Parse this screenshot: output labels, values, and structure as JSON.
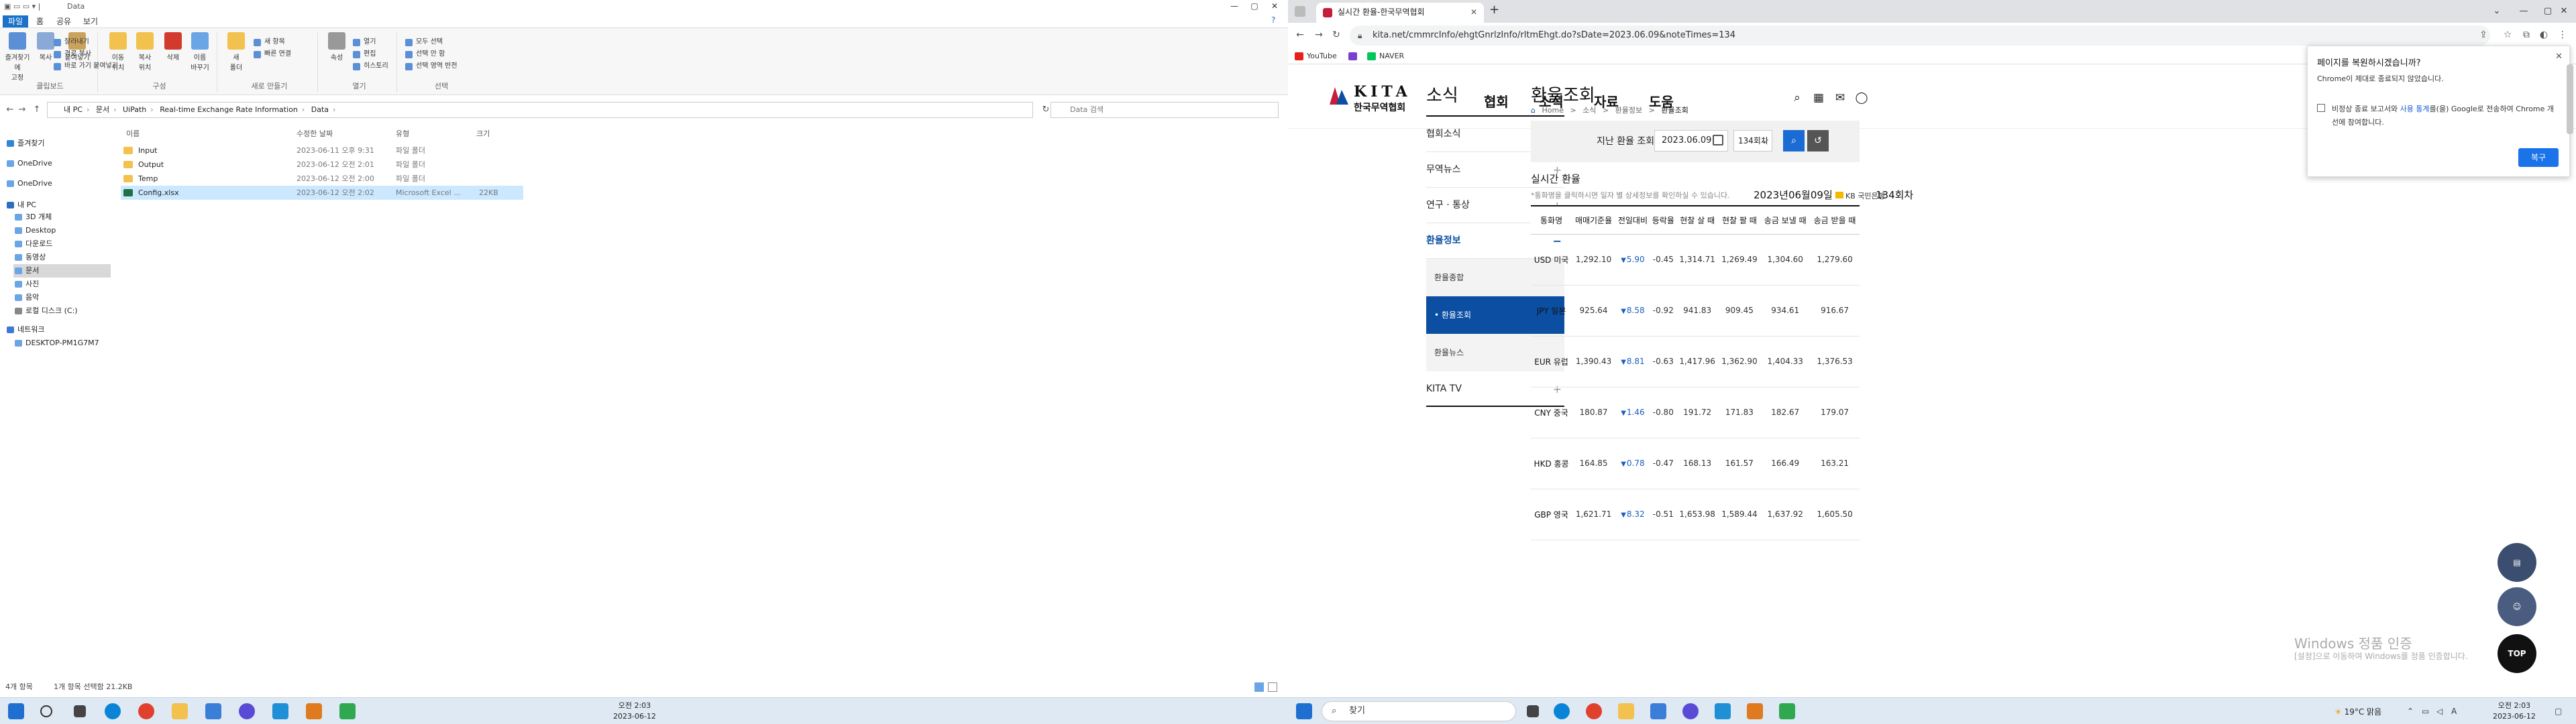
{
  "explorer": {
    "title": "Data",
    "tabs": [
      "파일",
      "홈",
      "공유",
      "보기"
    ],
    "ribbon": {
      "clipboard": {
        "group": "클립보드",
        "pin": "즐겨찾기에\n고정",
        "copy": "복사",
        "paste": "붙여넣기",
        "cut": "잘라내기",
        "copy_path": "경로 복사",
        "paste_shortcut": "바로 가기 붙여넣기"
      },
      "organize": {
        "group": "구성",
        "move_to": "이동\n위치",
        "copy_to": "복사\n위치",
        "delete": "삭제",
        "rename": "이름\n바꾸기"
      },
      "new": {
        "group": "새로 만들기",
        "new_folder": "새\n폴더",
        "new_item": "새 항목",
        "easy_access": "빠른 연결"
      },
      "open": {
        "group": "열기",
        "properties": "속성",
        "open": "열기",
        "edit": "편집",
        "history": "히스토리"
      },
      "select": {
        "group": "선택",
        "select_all": "모두 선택",
        "select_none": "선택 안 함",
        "invert": "선택 영역 반전"
      }
    },
    "address": [
      "내 PC",
      "문서",
      "UiPath",
      "Real-time Exchange Rate Information",
      "Data"
    ],
    "search_placeholder": "Data 검색",
    "nav": {
      "quick": "즐겨찾기",
      "onedrive1": "OneDrive",
      "onedrive2": "OneDrive",
      "pc": "내 PC",
      "obj3d": "3D 개체",
      "desktop": "Desktop",
      "downloads": "다운로드",
      "videos": "동영상",
      "docs": "문서",
      "pics": "사진",
      "music": "음악",
      "local": "로컬 디스크 (C:)",
      "network": "네트워크",
      "computer": "DESKTOP-PM1G7M7"
    },
    "columns": {
      "name": "이름",
      "modified": "수정한 날짜",
      "type": "유형",
      "size": "크기"
    },
    "files": [
      {
        "name": "Input",
        "date": "2023-06-11 오후 9:31",
        "type": "파일 폴더",
        "size": "",
        "kind": "folder"
      },
      {
        "name": "Output",
        "date": "2023-06-12 오전 2:01",
        "type": "파일 폴더",
        "size": "",
        "kind": "folder"
      },
      {
        "name": "Temp",
        "date": "2023-06-12 오전 2:00",
        "type": "파일 폴더",
        "size": "",
        "kind": "folder"
      },
      {
        "name": "Config.xlsx",
        "date": "2023-06-12 오전 2:02",
        "type": "Microsoft Excel ...",
        "size": "22KB",
        "kind": "xls"
      }
    ],
    "status": {
      "count": "4개 항목",
      "selected": "1개 항목 선택함 21.2KB"
    }
  },
  "chrome": {
    "tab_title": "실시간 환율-한국무역협회",
    "url": "kita.net/cmmrcInfo/ehgtGnrlzInfo/rltmEhgt.do?sDate=2023.06.09&noteTimes=134",
    "bookmarks": [
      "YouTube",
      "NAVER"
    ]
  },
  "site": {
    "logo_en": "KITA",
    "logo_ko": "한국무역협회",
    "gnav": [
      "협회",
      "소식",
      "자료",
      "도움"
    ],
    "lnb_title": "소식",
    "lnb": [
      {
        "label": "협회소식",
        "active": false
      },
      {
        "label": "무역뉴스",
        "active": false
      },
      {
        "label": "연구 · 통상",
        "active": false
      },
      {
        "label": "환율정보",
        "active": true
      }
    ],
    "lnb_sub": [
      "환율종합",
      "• 환율조회",
      "환율뉴스"
    ],
    "lnb_last": "KITA TV",
    "page_title": "환율조회",
    "breadcrumb": [
      "Home",
      ">",
      "소식",
      ">",
      "환율정보",
      ">",
      "환율조회"
    ],
    "search": {
      "label": "지난 환율 조회",
      "date": "2023.06.09",
      "round": "134회차"
    },
    "section_title": "실시간 환율",
    "section_note": "*통화명을 클릭하시면 일자 별 상세정보를 확인하실 수 있습니다.",
    "section_date": "2023년06월09일",
    "bank": "KB 국민은행",
    "round_label": "134회차",
    "table_headers": [
      "통화명",
      "매매기준율",
      "전일대비",
      "등락율",
      "현찰 살 때",
      "현찰 팔 때",
      "송금 보낼 때",
      "송금 받을 때"
    ],
    "rates": [
      {
        "cur": "USD 미국",
        "base": "1,292.10",
        "chg": "5.90",
        "pct": "-0.45",
        "cbuy": "1,314.71",
        "csell": "1,269.49",
        "send": "1,304.60",
        "recv": "1,279.60"
      },
      {
        "cur": "JPY 일본",
        "base": "925.64",
        "chg": "8.58",
        "pct": "-0.92",
        "cbuy": "941.83",
        "csell": "909.45",
        "send": "934.61",
        "recv": "916.67"
      },
      {
        "cur": "EUR 유럽",
        "base": "1,390.43",
        "chg": "8.81",
        "pct": "-0.63",
        "cbuy": "1,417.96",
        "csell": "1,362.90",
        "send": "1,404.33",
        "recv": "1,376.53"
      },
      {
        "cur": "CNY 중국",
        "base": "180.87",
        "chg": "1.46",
        "pct": "-0.80",
        "cbuy": "191.72",
        "csell": "171.83",
        "send": "182.67",
        "recv": "179.07"
      },
      {
        "cur": "HKD 홍콩",
        "base": "164.85",
        "chg": "0.78",
        "pct": "-0.47",
        "cbuy": "168.13",
        "csell": "161.57",
        "send": "166.49",
        "recv": "163.21"
      },
      {
        "cur": "GBP 영국",
        "base": "1,621.71",
        "chg": "8.32",
        "pct": "-0.51",
        "cbuy": "1,653.98",
        "csell": "1,589.44",
        "send": "1,637.92",
        "recv": "1,605.50"
      }
    ],
    "top_label": "TOP"
  },
  "restore_popup": {
    "title": "페이지를 복원하시겠습니까?",
    "subtitle": "Chrome이 제대로 종료되지 않았습니다.",
    "check_a": "비정상 종료 보고서와 ",
    "check_link": "사용 통계",
    "check_b": "를(을) Google로 전송하여 Chrome 개선에 참여합니다.",
    "button": "복구"
  },
  "windows_activation": {
    "line1": "Windows 정품 인증",
    "line2": "[설정]으로 이동하여 Windows를 정품 인증합니다."
  },
  "taskbar": {
    "search": "찾기",
    "time": "오전 2:03",
    "date": "2023-06-12",
    "weather": "19°C 맑음",
    "ime": "A"
  },
  "colors": {
    "accent": "#0b4ea2",
    "down": "#1c5fbf",
    "explorer_accent": "#1a73c9"
  }
}
